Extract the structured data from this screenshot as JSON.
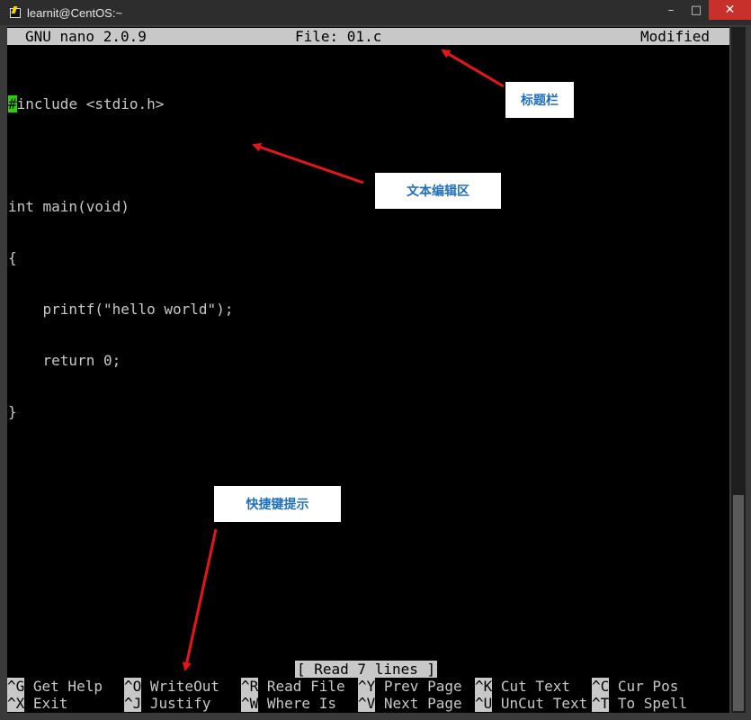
{
  "window": {
    "title": "learnit@CentOS:~",
    "controls": {
      "minimize": "–",
      "maximize": "□",
      "close": "✕"
    }
  },
  "nano": {
    "header": {
      "version": "GNU nano 2.0.9",
      "file": "File: 01.c",
      "state": "Modified"
    },
    "code_lines": [
      {
        "cursor_char": "#",
        "rest": "include <stdio.h>"
      },
      {
        "cursor_char": "",
        "rest": ""
      },
      {
        "cursor_char": "",
        "rest": "int main(void)"
      },
      {
        "cursor_char": "",
        "rest": "{"
      },
      {
        "cursor_char": "",
        "rest": "    printf(\"hello world\");"
      },
      {
        "cursor_char": "",
        "rest": "    return 0;"
      },
      {
        "cursor_char": "",
        "rest": "}"
      }
    ],
    "status_message": "[ Read 7 lines ]",
    "shortcuts": {
      "row1": [
        {
          "key": "^G",
          "label": " Get Help"
        },
        {
          "key": "^O",
          "label": " WriteOut"
        },
        {
          "key": "^R",
          "label": " Read File"
        },
        {
          "key": "^Y",
          "label": " Prev Page"
        },
        {
          "key": "^K",
          "label": " Cut Text"
        },
        {
          "key": "^C",
          "label": " Cur Pos"
        }
      ],
      "row2": [
        {
          "key": "^X",
          "label": " Exit"
        },
        {
          "key": "^J",
          "label": " Justify"
        },
        {
          "key": "^W",
          "label": " Where Is"
        },
        {
          "key": "^V",
          "label": " Next Page"
        },
        {
          "key": "^U",
          "label": " UnCut Text"
        },
        {
          "key": "^T",
          "label": " To Spell"
        }
      ]
    }
  },
  "annotations": {
    "title_bar": "标题栏",
    "edit_area": "文本编辑区",
    "shortcut_hints": "快捷键提示"
  },
  "colors": {
    "terminal_bg": "#000000",
    "terminal_fg": "#c8c8c8",
    "cursor": "#27d300",
    "annotation_text": "#1f6fbf",
    "arrow": "#e8141c",
    "close_button": "#c7302b"
  }
}
